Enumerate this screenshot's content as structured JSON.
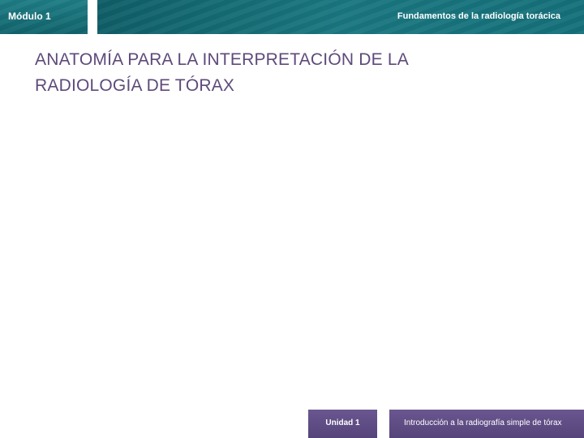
{
  "header": {
    "module_label": "Módulo 1",
    "course_title": "Fundamentos de la radiología torácica",
    "colors": {
      "teal_dark": "#11636c",
      "teal_light": "#1e7d85"
    }
  },
  "slide": {
    "title_line_1": "ANATOMÍA PARA LA INTERPRETACIÓN DE LA",
    "title_line_2": "RADIOLOGÍA DE TÓRAX",
    "title_color": "#5e4a7a"
  },
  "footer": {
    "unit_label": "Unidad 1",
    "unit_title": "Introducción a la radiografía simple de tórax",
    "color": "#5e4a7a"
  }
}
